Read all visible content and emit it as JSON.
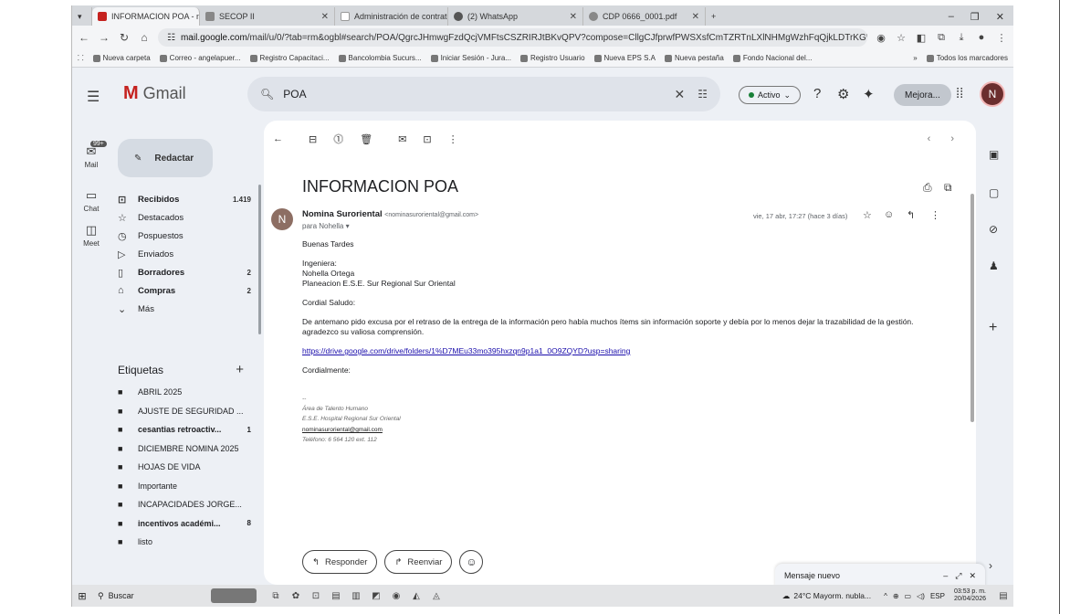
{
  "browser": {
    "tabs": [
      {
        "label": "INFORMACION POA - nomina",
        "active": true
      },
      {
        "label": "SECOP II",
        "active": false
      },
      {
        "label": "Administración de contratos",
        "active": false
      },
      {
        "label": "(2) WhatsApp",
        "active": false
      },
      {
        "label": "CDP 0666_0001.pdf",
        "active": false
      }
    ],
    "url_host": "mail.google.com",
    "url_path": "/mail/u/0/?tab=rm&ogbl#search/POA/QgrcJHmwgFzdQcjVMFtsCSZRIRJtBKvQPV?compose=CllgCJfprwfPWSXsfCmTZRTnLXlNHMgWzhFqQjkLDTrKGWRqkFrlBZbd...",
    "bookmarks": [
      "Nueva carpeta",
      "Correo - angelapuer...",
      "Registro Capacitaci...",
      "Bancolombia Sucurs...",
      "Iniciar Sesión - Jura...",
      "Registro Usuario",
      "Nueva EPS S.A",
      "Nueva pestaña",
      "Fondo Nacional del..."
    ],
    "bookmarks_more": "»",
    "all_bookmarks": "Todos los marcadores"
  },
  "gmail": {
    "app_name": "Gmail",
    "search_query": "POA",
    "status": "Activo",
    "upgrade": "Mejora...",
    "avatar_initial": "N",
    "rail": [
      {
        "label": "Mail",
        "badge": "99+"
      },
      {
        "label": "Chat"
      },
      {
        "label": "Meet"
      }
    ],
    "compose": "Redactar",
    "nav": [
      {
        "label": "Recibidos",
        "count": "1.419",
        "bold": true,
        "icon": "inbox-icon"
      },
      {
        "label": "Destacados",
        "count": "",
        "bold": false,
        "icon": "star-icon"
      },
      {
        "label": "Pospuestos",
        "count": "",
        "bold": false,
        "icon": "clock-icon"
      },
      {
        "label": "Enviados",
        "count": "",
        "bold": false,
        "icon": "send-icon"
      },
      {
        "label": "Borradores",
        "count": "2",
        "bold": true,
        "icon": "draft-icon"
      },
      {
        "label": "Compras",
        "count": "2",
        "bold": true,
        "icon": "tag-icon"
      },
      {
        "label": "Más",
        "count": "",
        "bold": false,
        "icon": "chevron-down-icon"
      }
    ],
    "labels_title": "Etiquetas",
    "labels": [
      {
        "label": "ABRIL 2025",
        "count": "",
        "bold": false
      },
      {
        "label": "AJUSTE DE SEGURIDAD ...",
        "count": "",
        "bold": false
      },
      {
        "label": "cesantias retroactiv...",
        "count": "1",
        "bold": true
      },
      {
        "label": "DICIEMBRE NOMINA 2025",
        "count": "",
        "bold": false
      },
      {
        "label": "HOJAS DE VIDA",
        "count": "",
        "bold": false
      },
      {
        "label": "Importante",
        "count": "",
        "bold": false
      },
      {
        "label": "INCAPACIDADES JORGE...",
        "count": "",
        "bold": false
      },
      {
        "label": "incentivos académi...",
        "count": "8",
        "bold": true
      },
      {
        "label": "listo",
        "count": "",
        "bold": false
      }
    ],
    "message": {
      "subject": "INFORMACION POA",
      "sender_name": "Nomina Suroriental",
      "sender_email": "<nominasuroriental@gmail.com>",
      "sender_initial": "N",
      "to": "para Nohella ▾",
      "date": "vie, 17 abr, 17:27 (hace 3 días)",
      "greeting": "Buenas Tardes",
      "addr_1": "Ingeniera:",
      "addr_2": "Nohella Ortega",
      "addr_3": "Planeacion E.S.E. Sur Regional Sur Oriental",
      "salute": "Cordial Saludo:",
      "para_1": "De antemano pido excusa por el retraso de la entrega de la información pero había muchos ítems sin información soporte y debía por lo menos dejar la trazabilidad de la gestión.",
      "para_2": "agradezco su valiosa comprensión.",
      "link": "https://drive.google.com/drive/folders/1%D7MEu33mo395hxzqn9p1a1_0O9ZQYD?usp=sharing",
      "closing": "Cordialmente:",
      "sig_dash": "--",
      "sig_1": "Área de Talento Humano",
      "sig_2": "E.S.E. Hospital Regional Sur Oriental",
      "sig_email": "nominasuroriental@gmail.com",
      "sig_phone": "Teléfono: 6 564 120 ext. 112"
    },
    "reply": "Responder",
    "forward": "Reenviar",
    "new_message": "Mensaje nuevo"
  },
  "taskbar": {
    "search": "Buscar",
    "weather": "24°C  Mayorm. nubla...",
    "lang": "ESP",
    "time": "03:53 p. m.",
    "date": "20/04/2026"
  }
}
